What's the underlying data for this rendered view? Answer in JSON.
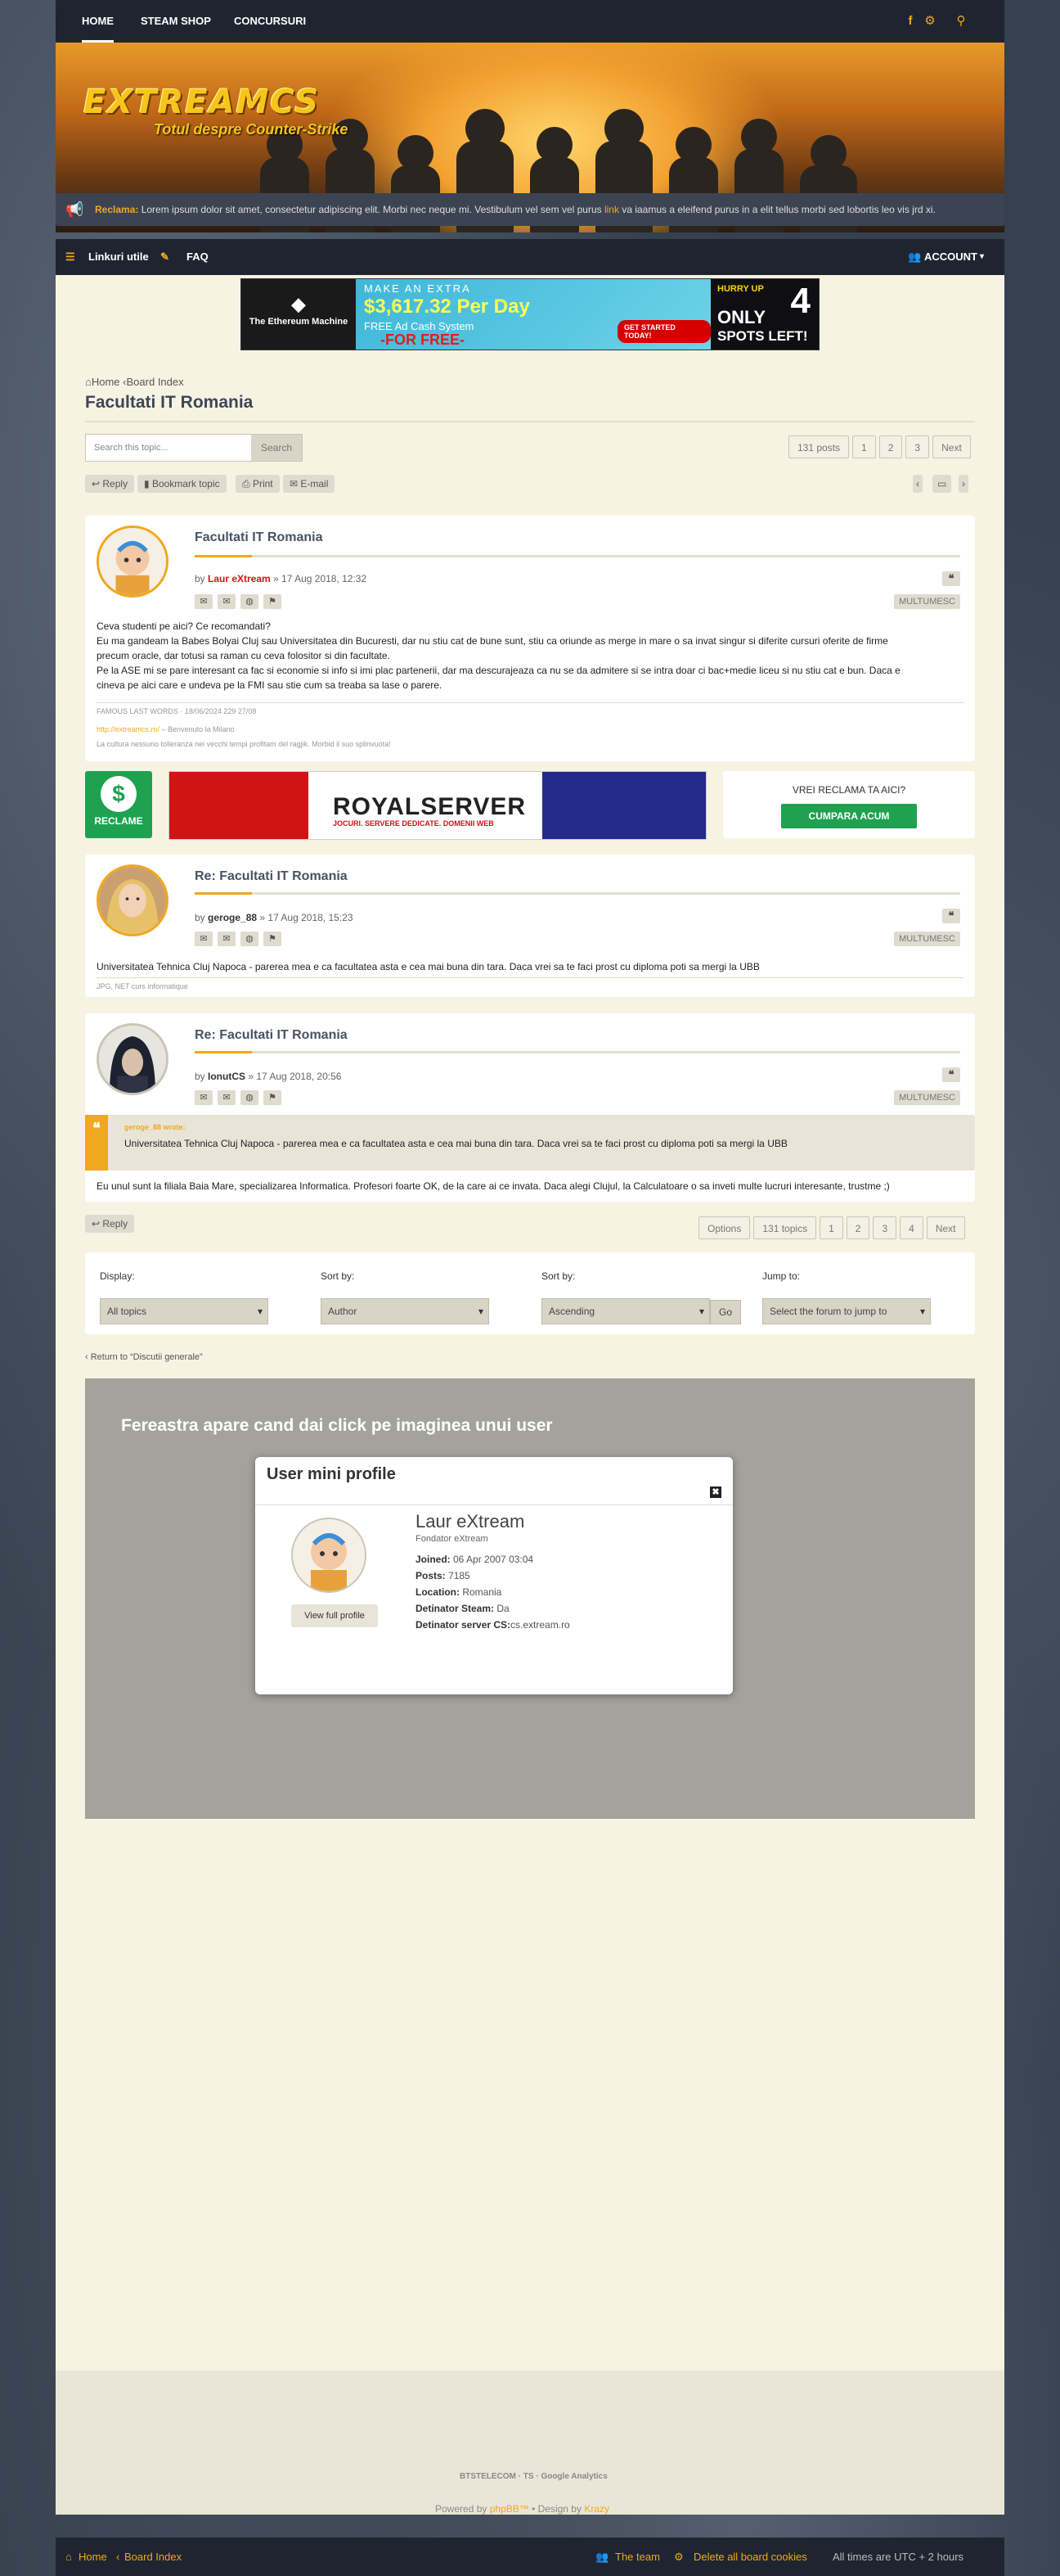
{
  "topnav": {
    "home": "HOME",
    "steam": "STEAM SHOP",
    "contests": "CONCURSURI"
  },
  "header": {
    "logo": "EXTREAMCS",
    "tagline": "Totul despre Counter-Strike"
  },
  "notice": {
    "label": "Reclama:",
    "text": " Lorem ipsum dolor sit amet, consectetur adipiscing elit. Morbi nec neque mi. Vestibulum vel sem vel purus ",
    "link": "link",
    "tail": " va iaamus a eleifend purus in a elit tellus morbi sed lobortis leo vis jrd xi."
  },
  "subnav": {
    "links": "Linkuri utile",
    "faq": "FAQ",
    "account": "ACCOUNT"
  },
  "ad_top": {
    "eth": "The Ethereum Machine",
    "l1": "MAKE AN EXTRA",
    "l2": "$3,617.32 Per Day",
    "l3": "FREE Ad Cash System",
    "l4": "-FOR FREE-",
    "btn": "GET STARTED TODAY!",
    "hurry": "HURRY UP",
    "only": "ONLY",
    "num": "4",
    "spots": "SPOTS LEFT!"
  },
  "breadcrumb": {
    "home": "Home",
    "board": "Board Index"
  },
  "topic": {
    "title": "Facultati IT Romania"
  },
  "search": {
    "placeholder": "Search this topic...",
    "button": "Search"
  },
  "pagination_top": {
    "posts": "131 posts",
    "p1": "1",
    "p2": "2",
    "p3": "3",
    "next": "Next"
  },
  "actions": {
    "reply": "Reply",
    "bookmark": "Bookmark topic",
    "print": "Print",
    "email": "E-mail"
  },
  "posts": [
    {
      "title": "Facultati IT Romania",
      "by": "by ",
      "author": "Laur eXtream",
      "date": " » 17 Aug 2018, 12:32",
      "thanks": "MULTUMESC",
      "l1": "Ceva studenti pe aici? Ce recomandati?",
      "l2": "Eu ma gandeam la Babes Bolyai Cluj sau Universitatea din Bucuresti, dar nu stiu cat de bune sunt, stiu ca oriunde as merge in mare o sa invat singur si diferite cursuri oferite de firme",
      "l3": "precum oracle, dar totusi sa raman cu ceva folositor si din facultate.",
      "l4": "Pe la ASE mi se pare interesant ca fac si economie si info si imi plac partenerii, dar ma descurajeaza ca nu se da admitere si se intra doar ci bac+medie liceu si nu stiu cat e bun. Daca e",
      "l5": "cineva pe aici care e undeva pe la FMI sau stie cum sa treaba sa lase o parere.",
      "edited": "FAMOUS LAST WORDS · 18/06/2024 229 27/08",
      "sig1": "http://extreamcs.ro/",
      "sig2": " – Benvenuto la Milano",
      "sig3": "La cultura nessuno tolleranza nei vecchi tempi profitam del ragjik. Morbid il suo splinvuota!"
    },
    {
      "title": "Re: Facultati IT Romania",
      "by": "by ",
      "author": "geroge_88",
      "date": " » 17 Aug 2018, 15:23",
      "thanks": "MULTUMESC",
      "l1": "Universitatea Tehnica Cluj Napoca - parerea mea e ca facultatea asta e cea mai buna din tara. Daca vrei sa te faci prost cu diploma poti sa mergi la UBB",
      "sig": "JPG, NET curs informatique"
    },
    {
      "title": "Re: Facultati IT Romania",
      "by": "by ",
      "author": "IonutCS",
      "date": " » 17 Aug 2018, 20:56",
      "thanks": "MULTUMESC",
      "qwho": "geroge_88 wrote:",
      "qtext": "Universitatea Tehnica Cluj Napoca - parerea mea e ca facultatea asta e cea mai buna din tara. Daca vrei sa te faci prost cu diploma poti sa mergi la UBB",
      "l1": "Eu unul sunt la filiala Baia Mare, specializarea Informatica. Profesori foarte OK, de la care ai ce invata. Daca alegi Clujul, la Calculatoare o sa inveti multe lucruri interesante, trustme ;)"
    }
  ],
  "reclame": {
    "label": "RECLAME",
    "royal": "ROYALSERVER",
    "royal_sub": "JOCURI. SERVERE DEDICATE. DOMENII WEB",
    "question": "VREI RECLAMA TA AICI?",
    "buy": "CUMPARA ACUM"
  },
  "pagination_bottom": {
    "options": "Options",
    "topics": "131 topics",
    "p1": "1",
    "p2": "2",
    "p3": "3",
    "p4": "4",
    "next": "Next"
  },
  "display": {
    "l_display": "Display:",
    "l_sort1": "Sort by:",
    "l_sort2": "Sort by:",
    "l_jump": "Jump to:",
    "v_display": "All topics",
    "v_sort1": "Author",
    "v_sort2": "Ascending",
    "go": "Go",
    "v_jump": "Select the forum to jump to"
  },
  "return": "‹ Return to “Discutii generale”",
  "demo": {
    "caption": "Fereastra apare cand dai click pe imaginea unui user",
    "title": "User mini profile",
    "close": "✖",
    "name": "Laur eXtream",
    "rank": "Fondator eXtream",
    "view": "View full profile",
    "joined_l": "Joined:",
    "joined": " 06 Apr 2007 03:04",
    "posts_l": "Posts:",
    "posts": " 7185",
    "loc_l": "Location:",
    "loc": " Romania",
    "steam_l": "Detinator Steam:",
    "steam": " Da",
    "server_l": "Detinator server CS:",
    "server": "cs.extream.ro"
  },
  "footer": {
    "logos": "BTSTELECOM · TS · Google Analytics",
    "powered": "Powered by ",
    "phpbb": "phpBB™",
    "design": " • Design by ",
    "designer": "Krazy"
  },
  "bottombar": {
    "home": "Home",
    "board": "Board Index",
    "team": "The team",
    "cookies": "Delete all board cookies",
    "tz": "All times are UTC + 2 hours"
  },
  "colors": {
    "accent": "#f0a81c",
    "nav": "#1f2530",
    "page": "#f7f3e3"
  }
}
